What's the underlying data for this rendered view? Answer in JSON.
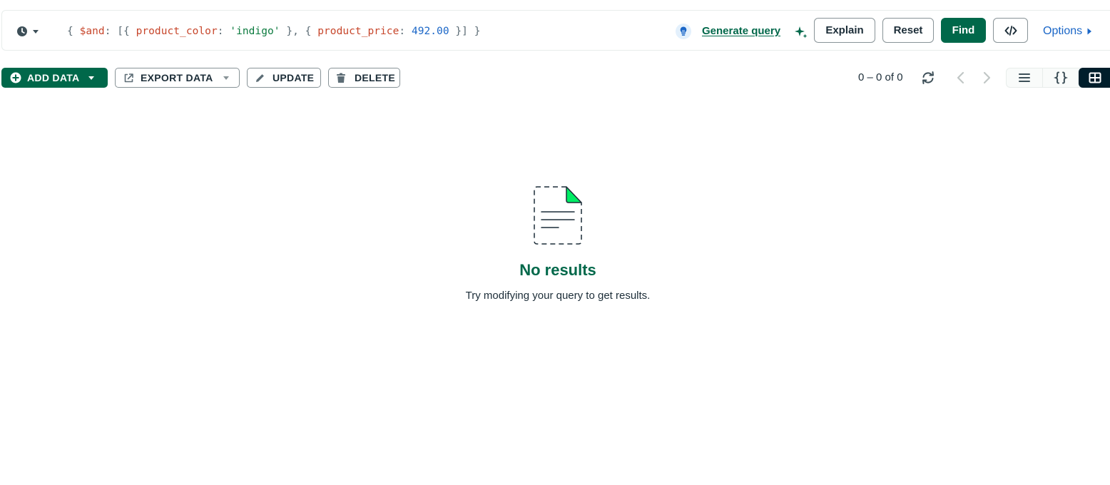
{
  "query_bar": {
    "history_icon": "clock-icon",
    "query": {
      "t1": "{ ",
      "t2": "$and",
      "t3": ": [{ ",
      "t4": "product_color",
      "t5": ": ",
      "t6": "'indigo'",
      "t7": " }, { ",
      "t8": "product_price",
      "t9": ": ",
      "t10": "492.00",
      "t11": " }] }"
    },
    "generate_query_label": "Generate query",
    "explain_label": "Explain",
    "reset_label": "Reset",
    "find_label": "Find",
    "code_label": "</>",
    "options_label": "Options"
  },
  "toolbar": {
    "add_data_label": "ADD DATA",
    "export_data_label": "EXPORT DATA",
    "update_label": "UPDATE",
    "delete_label": "DELETE"
  },
  "pagination": {
    "range_text": "0 – 0 of 0"
  },
  "view_toggle": {
    "options": [
      "list",
      "json",
      "table"
    ],
    "selected": "table"
  },
  "empty_state": {
    "title": "No results",
    "subtitle": "Try modifying your query to get results."
  },
  "colors": {
    "brand_green": "#00684a",
    "accent_green": "#00ed64",
    "link_blue": "#1a66c7",
    "dark": "#001e2b",
    "key_red": "#c7462b"
  }
}
